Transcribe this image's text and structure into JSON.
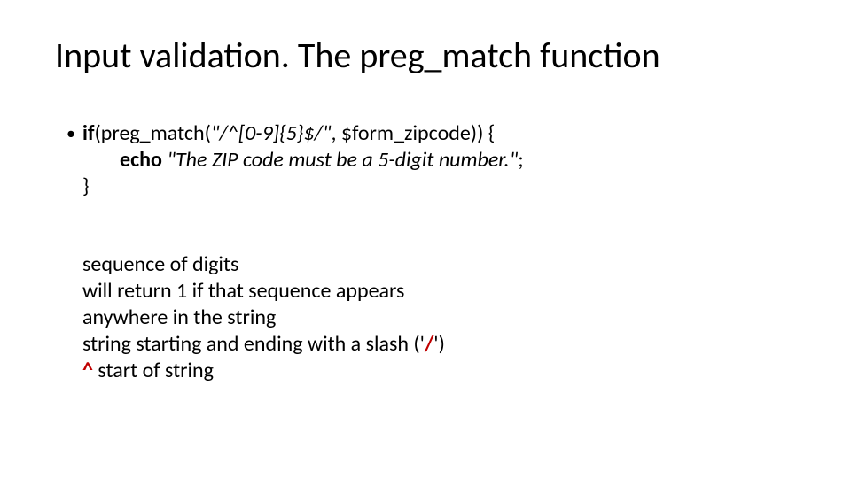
{
  "title": "Input validation. The preg_match function",
  "code": {
    "bullet": "•",
    "if_kw": "if",
    "if_rest_a": "(preg_match(",
    "if_pattern": "\"/^[0-9]{5}$/\"",
    "if_rest_b": ", $form_zipcode)) {",
    "echo_kw": "echo",
    "echo_str": " \"The ZIP code must be a 5-digit number.\"",
    "echo_semi": ";",
    "close": "}"
  },
  "notes": {
    "l1": "sequence of  digits",
    "l2": "will return 1 if that sequence appears",
    "l3": "anywhere in the string",
    "l4a": "string starting and ending with a slash ('",
    "l4slash": "/",
    "l4b": "')",
    "l5caret": "^",
    "l5rest": " start of string"
  }
}
